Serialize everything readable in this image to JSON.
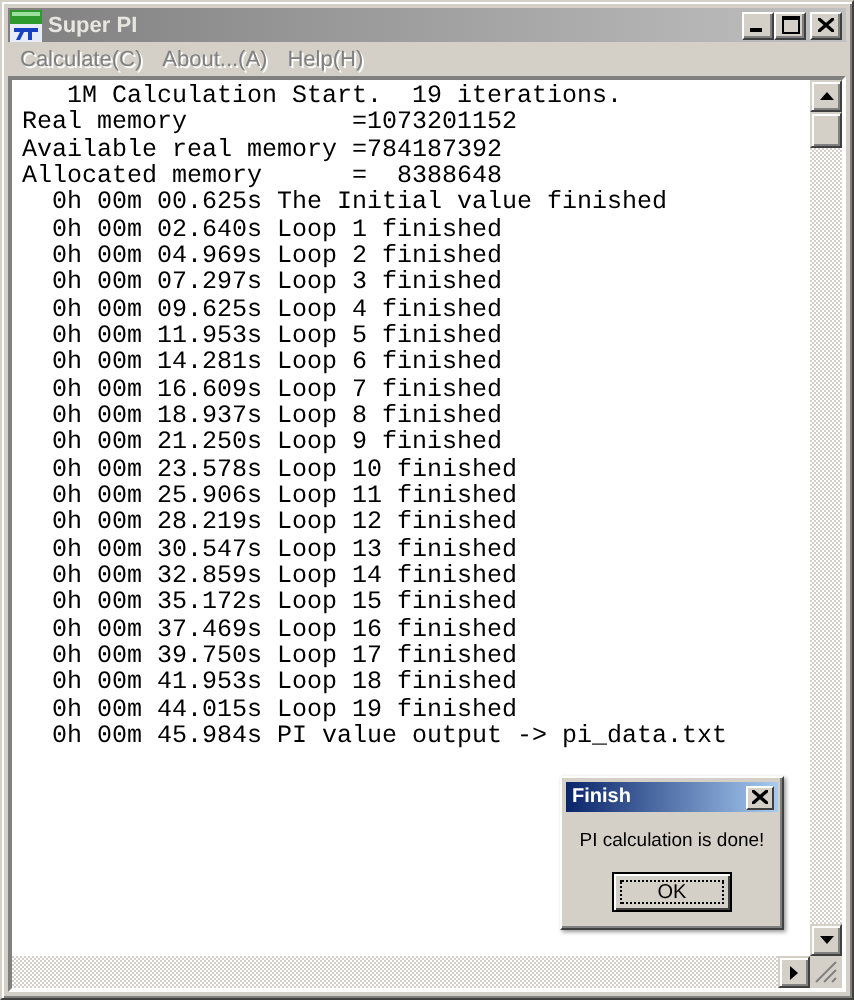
{
  "window": {
    "title": "Super PI",
    "active": false
  },
  "menu": [
    {
      "label": "Calculate(C)",
      "disabled": true
    },
    {
      "label": "About...(A)",
      "disabled": true
    },
    {
      "label": "Help(H)",
      "disabled": true
    }
  ],
  "output_lines": [
    "   1M Calculation Start.  19 iterations.",
    "Real memory           =1073201152",
    "Available real memory =784187392",
    "Allocated memory      =  8388648",
    "  0h 00m 00.625s The Initial value finished",
    "  0h 00m 02.640s Loop 1 finished",
    "  0h 00m 04.969s Loop 2 finished",
    "  0h 00m 07.297s Loop 3 finished",
    "  0h 00m 09.625s Loop 4 finished",
    "  0h 00m 11.953s Loop 5 finished",
    "  0h 00m 14.281s Loop 6 finished",
    "  0h 00m 16.609s Loop 7 finished",
    "  0h 00m 18.937s Loop 8 finished",
    "  0h 00m 21.250s Loop 9 finished",
    "  0h 00m 23.578s Loop 10 finished",
    "  0h 00m 25.906s Loop 11 finished",
    "  0h 00m 28.219s Loop 12 finished",
    "  0h 00m 30.547s Loop 13 finished",
    "  0h 00m 32.859s Loop 14 finished",
    "  0h 00m 35.172s Loop 15 finished",
    "  0h 00m 37.469s Loop 16 finished",
    "  0h 00m 39.750s Loop 17 finished",
    "  0h 00m 41.953s Loop 18 finished",
    "  0h 00m 44.015s Loop 19 finished",
    "  0h 00m 45.984s PI value output -> pi_data.txt"
  ],
  "dialog": {
    "title": "Finish",
    "active": true,
    "message": "PI calculation is done!",
    "button": "OK"
  }
}
